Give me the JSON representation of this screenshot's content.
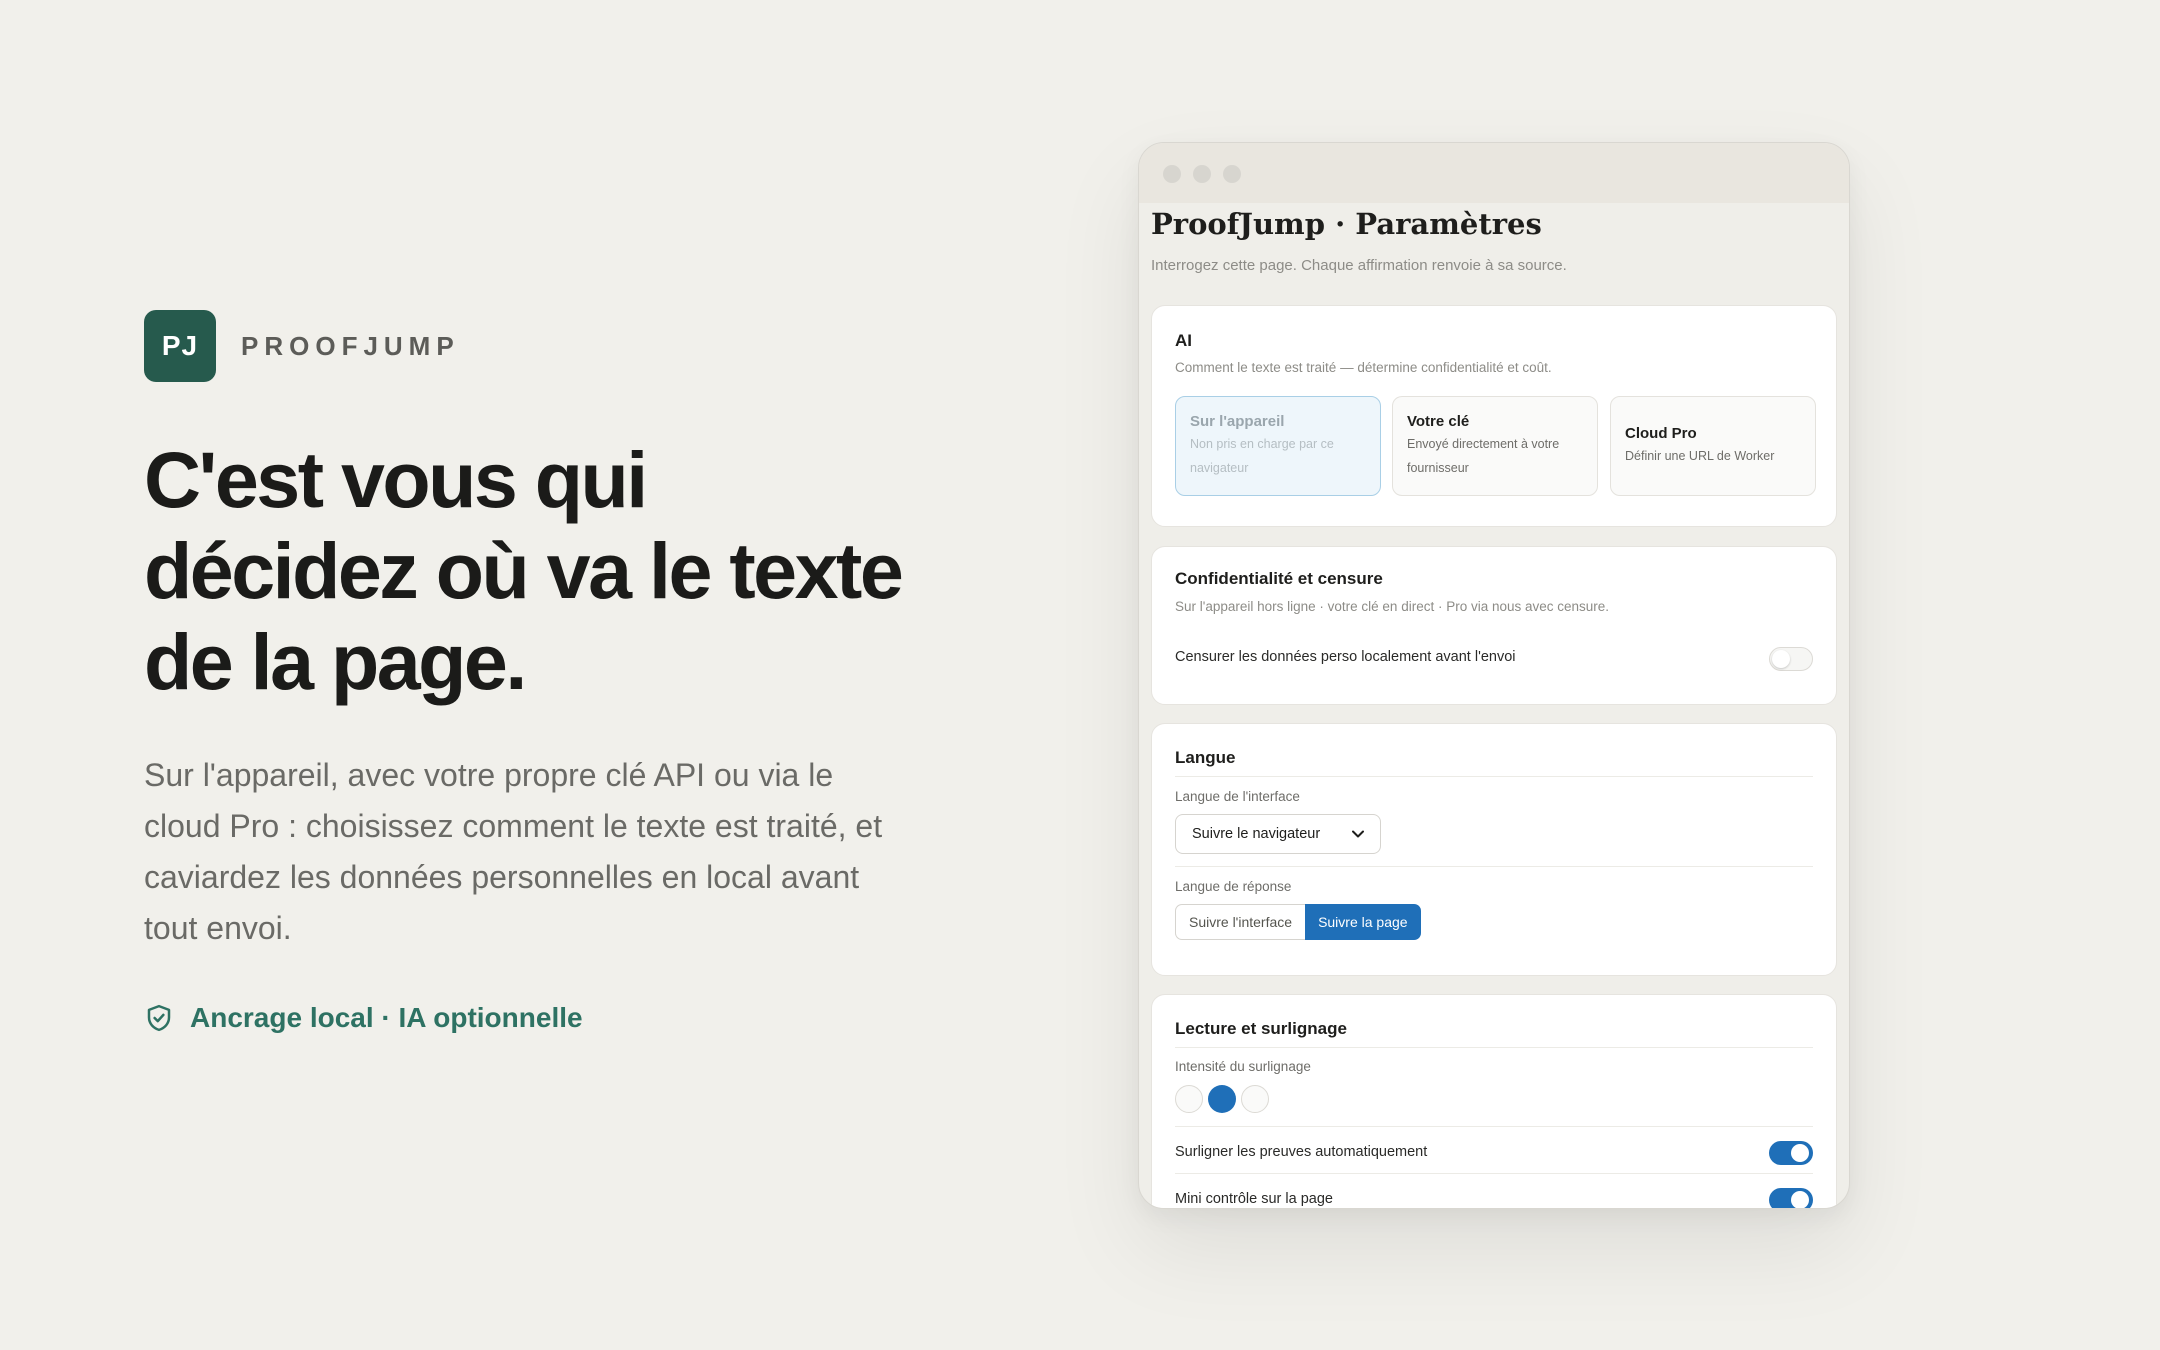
{
  "hero": {
    "logo_initials": "PJ",
    "brand": "PROOFJUMP",
    "headline": "C'est vous qui décidez où va le texte de la page.",
    "lede": "Sur l'appareil, avec votre propre clé API ou via le cloud Pro : choisissez comment le texte est traité, et caviardez les données personnelles en local avant tout envoi.",
    "badge": "Ancrage local · IA optionnelle",
    "badge_icon": "shield-check-icon"
  },
  "settings": {
    "title": "ProofJump · Paramètres",
    "subtitle": "Interrogez cette page. Chaque affirmation renvoie à sa source.",
    "ai": {
      "title": "AI",
      "description": "Comment le texte est traité — détermine confidentialité et coût.",
      "options": [
        {
          "title": "Sur l'appareil",
          "description": "Non pris en charge par ce navigateur",
          "selected": true
        },
        {
          "title": "Votre clé",
          "description": "Envoyé directement à votre fournisseur",
          "selected": false
        },
        {
          "title": "Cloud Pro",
          "description": "Définir une URL de Worker",
          "selected": false
        }
      ]
    },
    "privacy": {
      "title": "Confidentialité et censure",
      "description": "Sur l'appareil hors ligne · votre clé en direct · Pro via nous avec censure.",
      "redact_label": "Censurer les données perso localement avant l'envoi",
      "redact_enabled": false
    },
    "language": {
      "title": "Langue",
      "ui_label": "Langue de l'interface",
      "ui_value": "Suivre le navigateur",
      "response_label": "Langue de réponse",
      "response_options": [
        "Suivre l'interface",
        "Suivre la page"
      ],
      "response_selected": "Suivre la page"
    },
    "reading": {
      "title": "Lecture et surlignage",
      "intensity_label": "Intensité du surlignage",
      "intensity_selected": 2,
      "intensity_levels": 3,
      "auto_highlight_label": "Surligner les preuves automatiquement",
      "auto_highlight_enabled": true,
      "mini_control_label": "Mini contrôle sur la page",
      "mini_control_enabled": true
    }
  },
  "colors": {
    "accent": "#1f6fb8",
    "brand": "#265a4d",
    "badge_text": "#2e7263",
    "background": "#f1f0eb"
  }
}
